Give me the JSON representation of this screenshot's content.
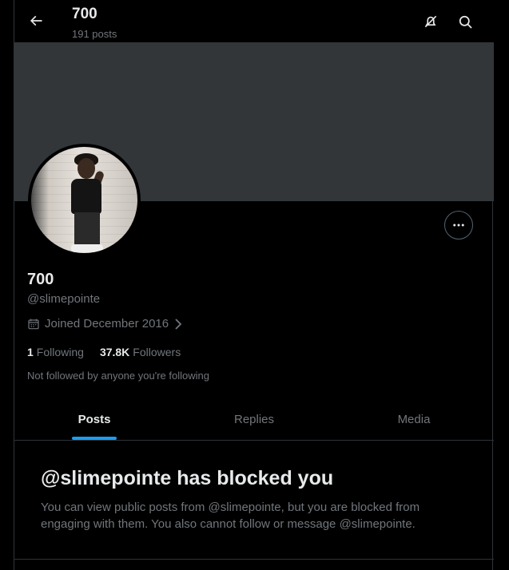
{
  "header": {
    "name": "700",
    "post_count": "191 posts"
  },
  "icons": {
    "back": "back-arrow-icon",
    "notifications_off": "notifications-off-icon",
    "search": "search-icon",
    "more": "more-horizontal-icon",
    "calendar": "calendar-icon",
    "chevron": "chevron-right-icon"
  },
  "profile": {
    "name": "700",
    "handle": "@slimepointe",
    "joined": "Joined December 2016",
    "following_count": "1",
    "following_label": "Following",
    "followers_count": "37.8K",
    "followers_label": "Followers",
    "followed_by": "Not followed by anyone you're following"
  },
  "tabs": [
    {
      "label": "Posts",
      "active": true
    },
    {
      "label": "Replies",
      "active": false
    },
    {
      "label": "Media",
      "active": false
    }
  ],
  "blocked": {
    "title": "@slimepointe has blocked you",
    "description": "You can view public posts from @slimepointe, but you are blocked from engaging with them. You also cannot follow or message @slimepointe."
  },
  "colors": {
    "background": "#000000",
    "banner": "#333639",
    "accent": "#1d9bf0",
    "secondary_text": "#71767b",
    "primary_text": "#e7e9ea"
  }
}
